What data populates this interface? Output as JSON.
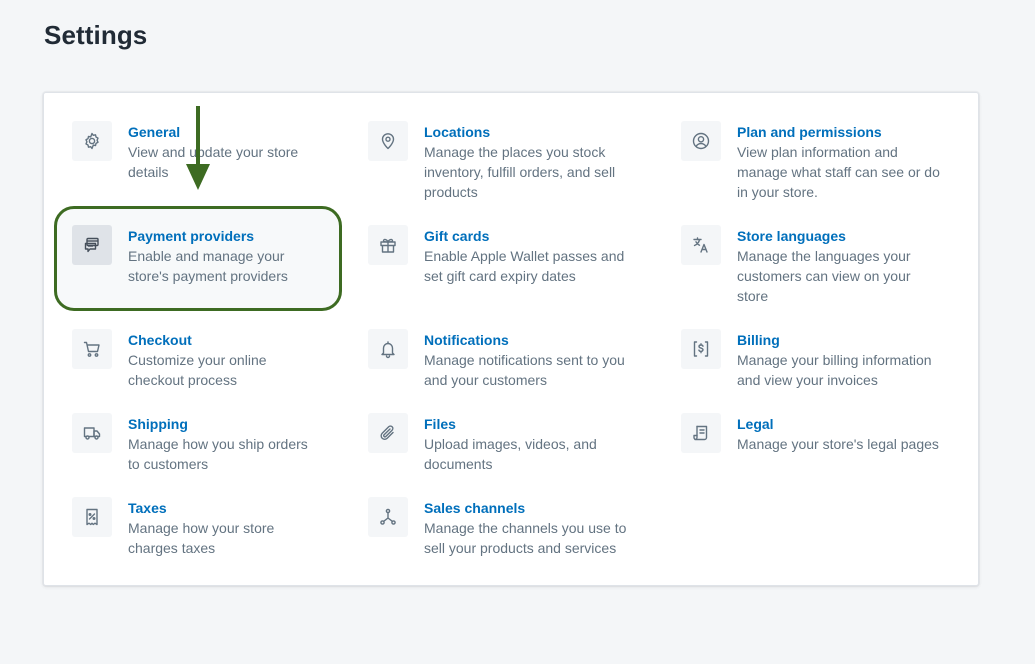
{
  "page": {
    "title": "Settings"
  },
  "colors": {
    "link": "#006fbb",
    "muted": "#637381",
    "highlight": "#3d6b22"
  },
  "settings": {
    "general": {
      "title": "General",
      "desc1": "View and update your store",
      "desc2": "details",
      "icon": "gear-icon"
    },
    "payment_providers": {
      "title": "Payment providers",
      "desc1": "Enable and manage your",
      "desc2": "store's payment providers",
      "icon": "payment-icon"
    },
    "checkout": {
      "title": "Checkout",
      "desc1": "Customize your online",
      "desc2": "checkout process",
      "icon": "cart-icon"
    },
    "shipping": {
      "title": "Shipping",
      "desc1": "Manage how you ship orders",
      "desc2": "to customers",
      "icon": "truck-icon"
    },
    "taxes": {
      "title": "Taxes",
      "desc1": "Manage how your store",
      "desc2": "charges taxes",
      "icon": "tax-receipt-icon"
    },
    "locations": {
      "title": "Locations",
      "desc1": "Manage the places you stock",
      "desc2": "inventory, fulfill orders, and sell",
      "desc3": "products",
      "icon": "location-pin-icon"
    },
    "gift_cards": {
      "title": "Gift cards",
      "desc1": "Enable Apple Wallet passes and",
      "desc2": "set gift card expiry dates",
      "icon": "gift-icon"
    },
    "notifications": {
      "title": "Notifications",
      "desc1": "Manage notifications sent to you",
      "desc2": "and your customers",
      "icon": "bell-icon"
    },
    "files": {
      "title": "Files",
      "desc1": "Upload images, videos, and",
      "desc2": "documents",
      "icon": "paperclip-icon"
    },
    "sales_channels": {
      "title": "Sales channels",
      "desc1": "Manage the channels you use to",
      "desc2": "sell your products and services",
      "icon": "channels-icon"
    },
    "plan_permissions": {
      "title": "Plan and permissions",
      "desc1": "View plan information and",
      "desc2": "manage what staff can see or do",
      "desc3": "in your store.",
      "icon": "user-circle-icon"
    },
    "store_languages": {
      "title": "Store languages",
      "desc1": "Manage the languages your",
      "desc2": "customers can view on your",
      "desc3": "store",
      "icon": "translate-icon"
    },
    "billing": {
      "title": "Billing",
      "desc1": "Manage your billing information",
      "desc2": "and view your invoices",
      "icon": "billing-icon"
    },
    "legal": {
      "title": "Legal",
      "desc1": "Manage your store's legal pages",
      "icon": "legal-document-icon"
    }
  }
}
